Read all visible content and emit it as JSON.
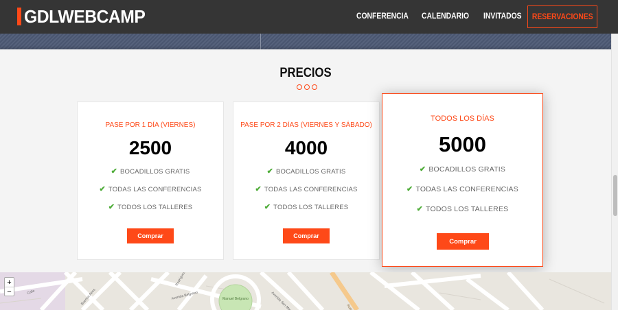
{
  "header": {
    "logo": "GDLWEBCAMP",
    "nav": [
      {
        "label": "CONFERENCIA"
      },
      {
        "label": "CALENDARIO"
      },
      {
        "label": "INVITADOS"
      },
      {
        "label": "RESERVACIONES"
      }
    ]
  },
  "pricing": {
    "title": "PRECIOS",
    "cards": [
      {
        "title": "PASE POR 1 DÍA (VIERNES)",
        "price": "2500",
        "features": [
          "BOCADILLOS GRATIS",
          "TODAS LAS CONFERENCIAS",
          "TODOS LOS TALLERES"
        ],
        "button": "Comprar"
      },
      {
        "title": "PASE POR 2 DÍAS (VIERNES Y SÁBADO)",
        "price": "4000",
        "features": [
          "BOCADILLOS GRATIS",
          "TODAS LAS CONFERENCIAS",
          "TODOS LOS TALLERES"
        ],
        "button": "Comprar"
      },
      {
        "title": "TODOS LOS DÍAS",
        "price": "5000",
        "features": [
          "BOCADILLOS GRATIS",
          "TODAS LAS CONFERENCIAS",
          "TODOS LOS TALLERES"
        ],
        "button": "Comprar",
        "featured": true
      }
    ]
  },
  "map": {
    "zoom_in": "+",
    "zoom_out": "−",
    "labels": [
      "Manuel Belgrano",
      "Avenida Belgrano",
      "Buenos Aires",
      "Ruta Nacional",
      "Avenida San Martín",
      "Rodríguez",
      "Calle"
    ]
  },
  "colors": {
    "accent": "#fe4918",
    "header_bg": "#353535",
    "check": "#4cab36",
    "park": "#c8e6b4"
  },
  "icons": {
    "check": "check-icon",
    "zoom_in": "plus-icon",
    "zoom_out": "minus-icon"
  }
}
